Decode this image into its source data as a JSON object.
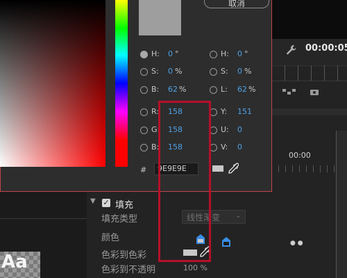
{
  "picker": {
    "cancel_label": "取消",
    "preview_color": "#9e9e9e",
    "hex_symbol": "#",
    "hex_value": "9E9E9E",
    "fields": {
      "hsb_h": {
        "label": "H:",
        "value": "0",
        "unit": "°"
      },
      "hsb_s": {
        "label": "S:",
        "value": "0",
        "unit": "%"
      },
      "hsb_b": {
        "label": "B:",
        "value": "62",
        "unit": "%"
      },
      "hsl_h": {
        "label": "H:",
        "value": "0",
        "unit": "°"
      },
      "hsl_s": {
        "label": "S:",
        "value": "0",
        "unit": "%"
      },
      "hsl_l": {
        "label": "L:",
        "value": "62",
        "unit": "%"
      },
      "r": {
        "label": "R:",
        "value": "158"
      },
      "g": {
        "label": "G:",
        "value": "158"
      },
      "b": {
        "label": "B:",
        "value": "158"
      },
      "y": {
        "label": "Y:",
        "value": "151"
      },
      "u": {
        "label": "U:",
        "value": "0"
      },
      "v": {
        "label": "V:",
        "value": "0"
      }
    }
  },
  "timeline": {
    "timecode": "00:00:05",
    "timecode2": "00:00"
  },
  "properties": {
    "fill_label": "填充",
    "fill_type_label": "填充类型",
    "fill_type_value": "线性渐变",
    "color_label": "颜色",
    "color_to_color_label": "色彩到色彩",
    "color_to_opacity_label": "色彩到不透明",
    "opacity_value": "100 %"
  },
  "thumbnail": {
    "label": "Aa"
  },
  "colors": {
    "accent_blue": "#4ea1e6",
    "highlight_red": "#b5102a",
    "dialog_border": "#c0444c",
    "stop_blue": "#3a8ee6"
  }
}
